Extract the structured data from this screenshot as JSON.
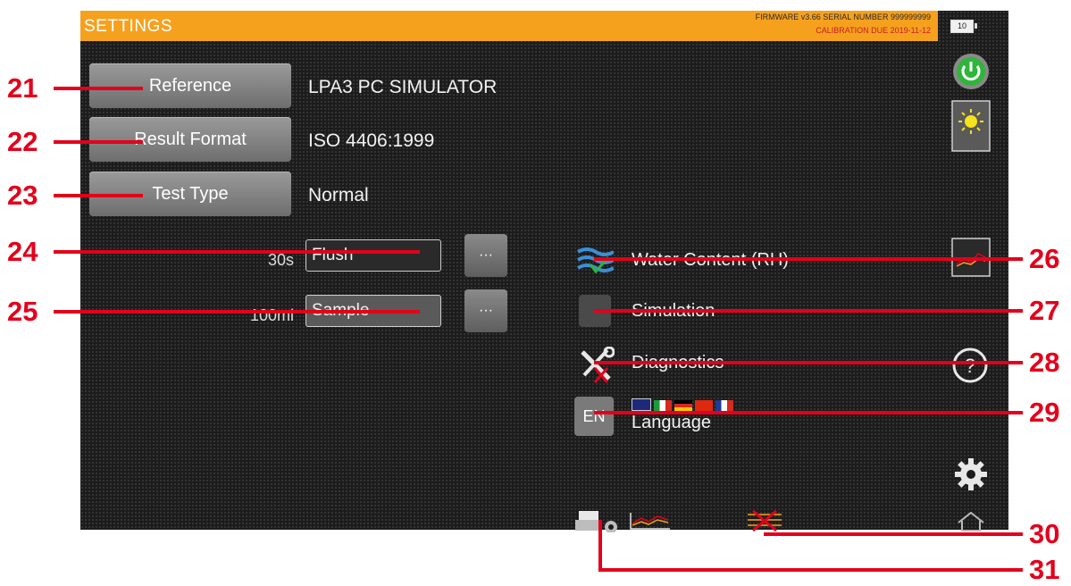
{
  "header": {
    "title": "SETTINGS",
    "firmware": "FIRMWARE v3.66 SERIAL NUMBER 999999999",
    "calibration": "CALIBRATION DUE 2019-11-12",
    "battery": "10"
  },
  "settings": {
    "reference_label": "Reference",
    "reference_value": "LPA3 PC SIMULATOR",
    "result_format_label": "Result Format",
    "result_format_value": "ISO 4406:1999",
    "test_type_label": "Test Type",
    "test_type_value": "Normal"
  },
  "steps": [
    {
      "amount": "30s",
      "name": "Flush",
      "more": "···"
    },
    {
      "amount": "100ml",
      "name": "Sample",
      "more": "···"
    }
  ],
  "options": {
    "water_content": "Water Content (RH)",
    "simulation": "Simulation",
    "diagnostics": "Diagnostics",
    "language_code": "EN",
    "language": "Language"
  },
  "callouts": [
    "21",
    "22",
    "23",
    "24",
    "25",
    "26",
    "27",
    "28",
    "29",
    "30",
    "31"
  ],
  "colors": {
    "topbar": "#f5a11e",
    "callout": "#e3001b",
    "power": "#2fb53a"
  }
}
